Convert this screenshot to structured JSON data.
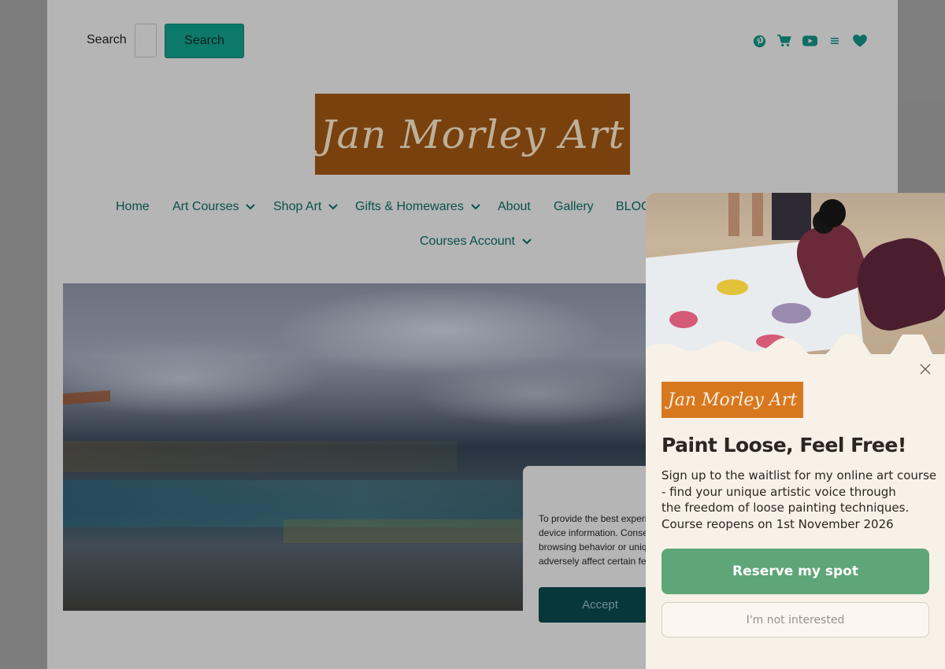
{
  "header": {
    "search_label": "Search",
    "search_value": "",
    "search_button": "Search",
    "social_icons": [
      "pinterest-icon",
      "cart-icon",
      "youtube-icon",
      "menu-icon",
      "heart-icon"
    ],
    "accent_color": "#0f8a7a"
  },
  "logo": {
    "text": "Jan Morley Art"
  },
  "nav": {
    "items": [
      {
        "label": "Home",
        "has_dropdown": false
      },
      {
        "label": "Art Courses",
        "has_dropdown": true
      },
      {
        "label": "Shop Art",
        "has_dropdown": true
      },
      {
        "label": "Gifts & Homewares",
        "has_dropdown": true
      },
      {
        "label": "About",
        "has_dropdown": false
      },
      {
        "label": "Gallery",
        "has_dropdown": false
      },
      {
        "label": "BLOG",
        "has_dropdown": false
      },
      {
        "label": "Courses Account",
        "has_dropdown": true
      }
    ]
  },
  "cookie_banner": {
    "lines": [
      "To provide the best experiences, we use technologies like cookies to store and/or access",
      "device information. Consenting to these technologies will allow us to process data such as",
      "browsing behavior or unique IDs on this site. Not consenting or withdrawing consent, may",
      "adversely affect certain features and functions."
    ],
    "accept_label": "Accept"
  },
  "popup": {
    "logo_text": "Jan Morley Art",
    "title": "Paint Loose, Feel Free!",
    "body_lines": [
      "Sign up to the waitlist for my online art course",
      "- find your unique artistic voice through",
      "the freedom of loose painting techniques.",
      "Course reopens on 1st November 2026"
    ],
    "reserve_label": "Reserve my spot",
    "decline_label": "I'm not interested",
    "reserve_color": "#5ea677",
    "background_color": "#f8f1e7"
  }
}
